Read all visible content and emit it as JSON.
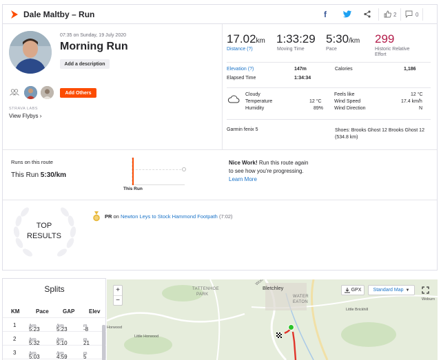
{
  "header": {
    "title": "Dale Maltby – Run",
    "kudos_count": "2",
    "comments_count": "0"
  },
  "activity": {
    "datetime": "07:35 on Sunday, 19 July 2020",
    "name": "Morning Run",
    "add_description": "Add a description",
    "add_others": "Add Others",
    "strava_labs": "STRAVA LABS",
    "view_flybys": "View Flybys ›"
  },
  "stats": {
    "distance_value": "17.02",
    "distance_unit": "km",
    "distance_label": "Distance (?)",
    "moving_time_value": "1:33:29",
    "moving_time_label": "Moving Time",
    "pace_value": "5:30",
    "pace_unit": "/km",
    "pace_label": "Pace",
    "effort_value": "299",
    "effort_label_1": "Historic Relative",
    "effort_label_2": "Effort"
  },
  "details": {
    "elevation_label": "Elevation (?)",
    "elevation_value": "147m",
    "calories_label": "Calories",
    "calories_value": "1,186",
    "elapsed_label": "Elapsed Time",
    "elapsed_value": "1:34:34"
  },
  "weather": {
    "condition": "Cloudy",
    "temperature_label": "Temperature",
    "temperature_value": "12 °C",
    "humidity_label": "Humidity",
    "humidity_value": "89%",
    "feels_like_label": "Feels like",
    "feels_like_value": "12 °C",
    "wind_speed_label": "Wind Speed",
    "wind_speed_value": "17.4 km/h",
    "wind_direction_label": "Wind Direction",
    "wind_direction_value": "N"
  },
  "gear": {
    "device": "Garmin fenix 5",
    "shoes_1": "Shoes: Brooks Ghost 12 Brooks Ghost 12",
    "shoes_2": "(534.8 km)"
  },
  "route": {
    "runs_label": "Runs on this route",
    "this_run_label": "This Run",
    "this_run_value": "5:30/km",
    "chart_label": "This Run",
    "nice_work": "Nice Work!",
    "nice_work_text_1": "Run this route again",
    "nice_work_text_2": "to see how you're progressing.",
    "learn_more": "Learn More"
  },
  "results": {
    "top_line_1": "TOP",
    "top_line_2": "RESULTS",
    "pr_prefix": "PR",
    "pr_on": "on",
    "pr_segment": "Newton Leys to Stock Hammond Footpath",
    "pr_time": "(7:02)"
  },
  "splits": {
    "title": "Splits",
    "columns": [
      "KM",
      "Pace",
      "GAP",
      "Elev"
    ],
    "rows": [
      {
        "km": "1",
        "pace": "5:23",
        "gap": "5:23",
        "elev": "-8"
      },
      {
        "km": "2",
        "pace": "5:32",
        "gap": "5:10",
        "elev": "21"
      },
      {
        "km": "3",
        "pace": "5:03",
        "gap": "4:59",
        "elev": "5"
      }
    ],
    "unit_per_km": "/km",
    "unit_m": "m"
  },
  "map": {
    "zoom_in": "+",
    "zoom_out": "−",
    "gpx_label": "GPX",
    "map_type": "Standard Map",
    "labels": [
      "TATTENHOE",
      "PARK",
      "Bletchley",
      "WATER",
      "EATON",
      "Little Brickhill",
      "Woburn",
      "Horwood",
      "Little Horwood",
      "Wood"
    ]
  }
}
